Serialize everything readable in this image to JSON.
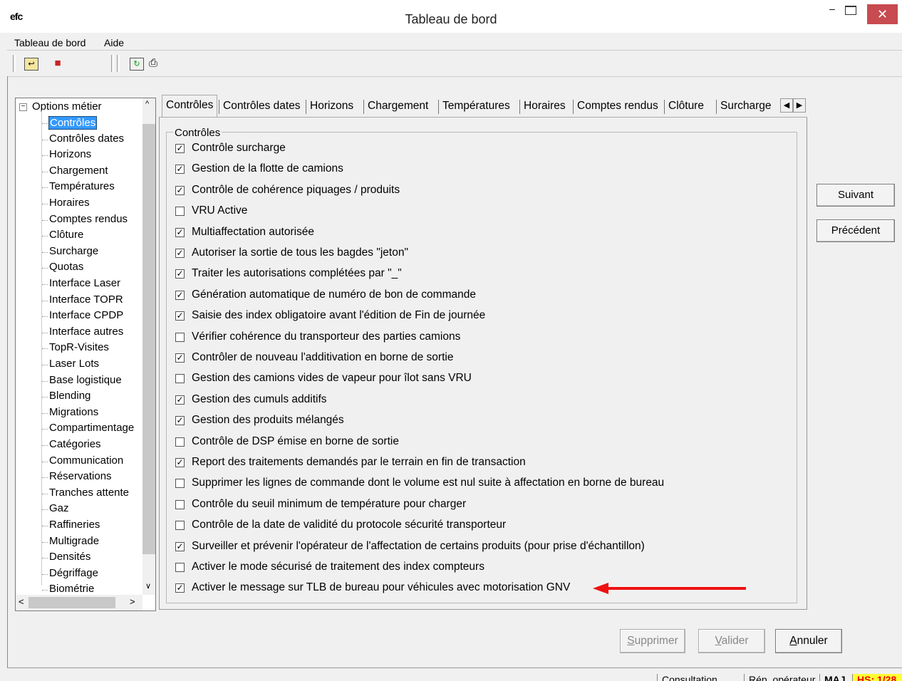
{
  "window": {
    "title": "Tableau de bord",
    "app_icon": "efc"
  },
  "menu": {
    "items": [
      "Tableau de bord",
      "Aide"
    ]
  },
  "tree": {
    "root": "Options métier",
    "items": [
      "Contrôles",
      "Contrôles dates",
      "Horizons",
      "Chargement",
      "Températures",
      "Horaires",
      "Comptes rendus",
      "Clôture",
      "Surcharge",
      "Quotas",
      "Interface Laser",
      "Interface TOPR",
      "Interface CPDP",
      "Interface autres",
      "TopR-Visites",
      "Laser Lots",
      "Base logistique",
      "Blending",
      "Migrations",
      "Compartimentage",
      "Catégories",
      "Communication",
      "Réservations",
      "Tranches attente",
      "Gaz",
      "Raffineries",
      "Multigrade",
      "Densités",
      "Dégriffage",
      "Biométrie"
    ],
    "selected": "Contrôles"
  },
  "tabs": [
    "Contrôles",
    "Contrôles dates",
    "Horizons",
    "Chargement",
    "Températures",
    "Horaires",
    "Comptes rendus",
    "Clôture",
    "Surcharge"
  ],
  "group": {
    "label": "Contrôles"
  },
  "options": [
    {
      "label": "Contrôle surcharge",
      "checked": true
    },
    {
      "label": "Gestion de la flotte de camions",
      "checked": true
    },
    {
      "label": "Contrôle de cohérence piquages / produits",
      "checked": true
    },
    {
      "label": "VRU Active",
      "checked": false
    },
    {
      "label": "Multiaffectation autorisée",
      "checked": true
    },
    {
      "label": "Autoriser la sortie de tous les bagdes \"jeton\"",
      "checked": true
    },
    {
      "label": "Traiter les autorisations complétées par \"_\"",
      "checked": true
    },
    {
      "label": "Génération automatique de numéro de bon de commande",
      "checked": true
    },
    {
      "label": "Saisie des index obligatoire avant l'édition de Fin de journée",
      "checked": true
    },
    {
      "label": "Vérifier cohérence du transporteur des parties camions",
      "checked": false
    },
    {
      "label": "Contrôler de nouveau l'additivation en borne de sortie",
      "checked": true
    },
    {
      "label": "Gestion des camions vides de vapeur pour îlot sans VRU",
      "checked": false
    },
    {
      "label": "Gestion des cumuls additifs",
      "checked": true
    },
    {
      "label": "Gestion des produits mélangés",
      "checked": true
    },
    {
      "label": "Contrôle de DSP émise en borne de sortie",
      "checked": false
    },
    {
      "label": "Report des traitements demandés par le terrain en fin de transaction",
      "checked": true
    },
    {
      "label": "Supprimer les lignes de commande dont le volume est nul suite à affectation en borne de bureau",
      "checked": false
    },
    {
      "label": "Contrôle du seuil minimum de température pour charger",
      "checked": false
    },
    {
      "label": "Contrôle de la date de validité du protocole sécurité transporteur",
      "checked": false
    },
    {
      "label": "Surveiller et prévenir l'opérateur de l'affectation de certains produits  (pour prise d'échantillon)",
      "checked": true
    },
    {
      "label": "Activer le mode sécurisé de traitement des index compteurs",
      "checked": false
    },
    {
      "label": "Activer le message sur TLB de bureau pour véhicules avec motorisation GNV",
      "checked": true
    }
  ],
  "buttons": {
    "next": "Suivant",
    "prev": "Précédent",
    "delete_first": "S",
    "delete_rest": "upprimer",
    "validate_first": "V",
    "validate_rest": "alider",
    "cancel_first": "A",
    "cancel_rest": "nnuler"
  },
  "status": {
    "mode": "Consultation",
    "rep": "Rép. opérateur",
    "caps": "MAJ",
    "hs": "HS: 1/28"
  },
  "colors": {
    "selection": "#3399ff",
    "close": "#c74b50",
    "arrow": "#ee1111",
    "hs_bg": "#ffff33"
  }
}
